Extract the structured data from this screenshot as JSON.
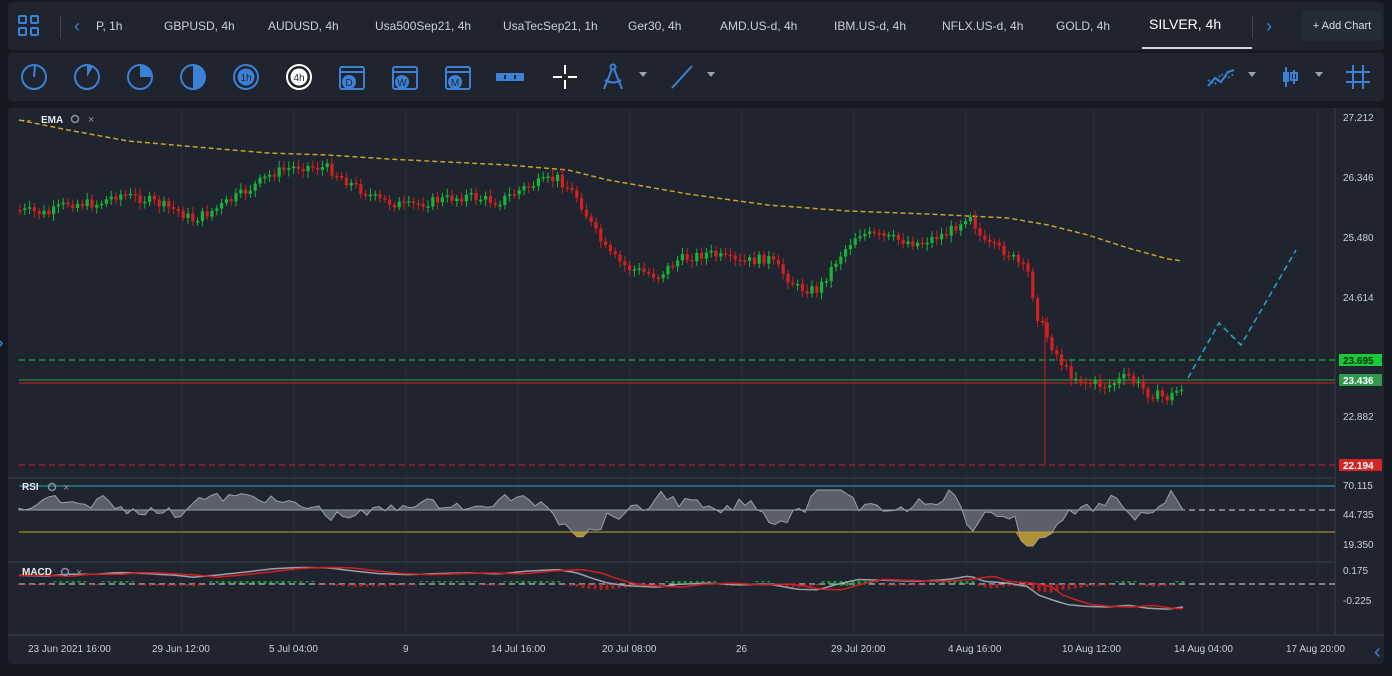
{
  "tabs": [
    {
      "label": "P, 1h"
    },
    {
      "label": "GBPUSD, 4h"
    },
    {
      "label": "AUDUSD, 4h"
    },
    {
      "label": "Usa500Sep21, 4h"
    },
    {
      "label": "UsaTecSep21, 1h"
    },
    {
      "label": "Ger30, 4h"
    },
    {
      "label": "AMD.US-d, 4h"
    },
    {
      "label": "IBM.US-d, 4h"
    },
    {
      "label": "NFLX.US-d, 4h"
    },
    {
      "label": "GOLD, 4h"
    },
    {
      "label": "SILVER, 4h",
      "active": true
    }
  ],
  "add_chart_label": "+ Add Chart",
  "toolbar": {
    "timeframe_icons": [
      "clock-1m-icon",
      "clock-5m-icon",
      "clock-15m-icon",
      "clock-30m-icon",
      "clock-1h-icon",
      "clock-4h-icon",
      "calendar-day-icon",
      "calendar-week-icon",
      "calendar-month-icon"
    ],
    "timeframe_badges": [
      "",
      "",
      "",
      "",
      "1h",
      "4h",
      "D",
      "W",
      "M"
    ],
    "drawing_icons": [
      "ruler-icon",
      "crosshair-icon",
      "compass-icon",
      "trendline-icon"
    ],
    "right_icons": [
      "indicators-icon",
      "chart-type-icon",
      "grid-icon"
    ]
  },
  "panes": {
    "main": {
      "indicator": "EMA"
    },
    "rsi": {
      "indicator": "RSI"
    },
    "macd": {
      "indicator": "MACD"
    }
  },
  "price_axis": [
    "27.212",
    "26.346",
    "25.480",
    "24.614",
    "22.882"
  ],
  "price_tags": [
    {
      "value": "23.695",
      "color": "#18c93a"
    },
    {
      "value": "23.436",
      "color": "#2f9a4c"
    },
    {
      "value": "22.194",
      "color": "#d32525"
    }
  ],
  "rsi_axis": [
    "70.115",
    "44.735",
    "19.350"
  ],
  "macd_axis": [
    "0.175",
    "-0.225"
  ],
  "time_axis": [
    "23 Jun 2021 16:00",
    "29 Jun 12:00",
    "5 Jul 04:00",
    "9",
    "14 Jul 16:00",
    "20 Jul 08:00",
    "26",
    "29 Jul 20:00",
    "4 Aug 16:00",
    "10 Aug 12:00",
    "14 Aug 04:00",
    "17 Aug 20:00"
  ],
  "colors": {
    "up": "#18b43a",
    "down": "#d02020",
    "ema": "#c9a227",
    "accent": "#3b82d6",
    "forecast": "#22a9c4"
  }
}
